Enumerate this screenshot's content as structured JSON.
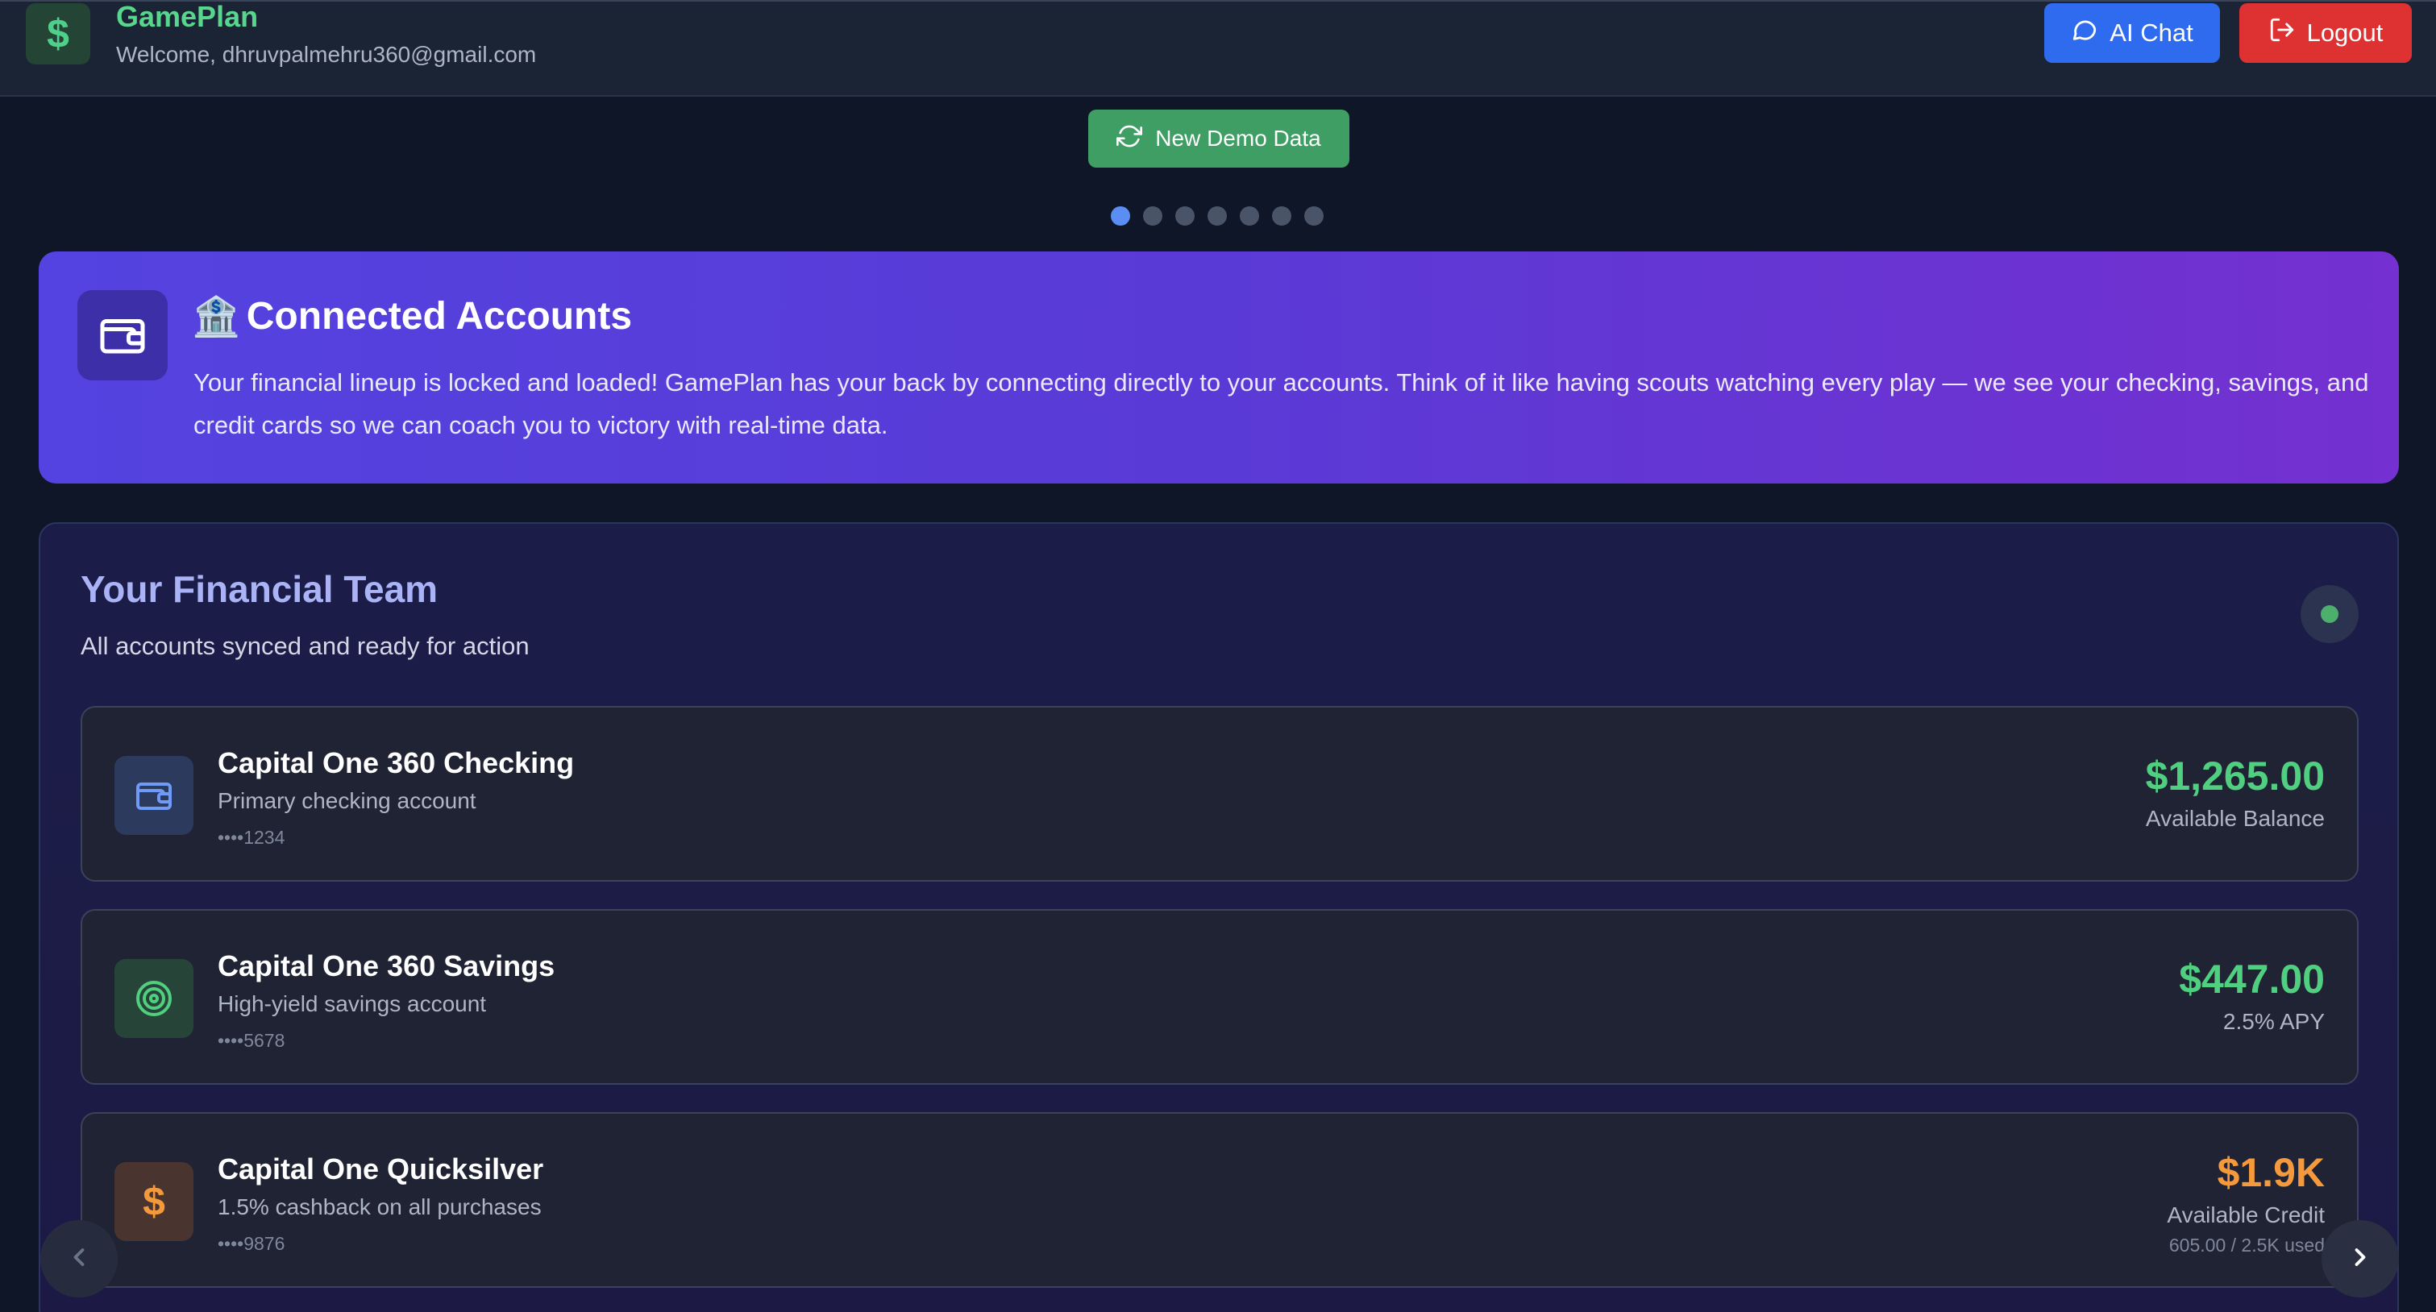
{
  "header": {
    "brand": "GamePlan",
    "logo_glyph": "$",
    "welcome": "Welcome, dhruvpalmehru360@gmail.com",
    "ai_chat_label": "AI Chat",
    "logout_label": "Logout"
  },
  "demo": {
    "label": "New Demo Data"
  },
  "carousel": {
    "total": 7,
    "active": 0
  },
  "hero": {
    "emoji": "🏦",
    "title": "Connected Accounts",
    "text": "Your financial lineup is locked and loaded! GamePlan has your back by connecting directly to your accounts. Think of it like having scouts watching every play — we see your checking, savings, and credit cards so we can coach you to victory with real-time data."
  },
  "team": {
    "title": "Your Financial Team",
    "subtitle": "All accounts synced and ready for action",
    "accounts": [
      {
        "name": "Capital One 360 Checking",
        "description": "Primary checking account",
        "number": "••••1234",
        "amount": "$1,265.00",
        "label": "Available Balance",
        "used": "",
        "icon": "wallet-icon",
        "color": "#4fcf7f"
      },
      {
        "name": "Capital One 360 Savings",
        "description": "High-yield savings account",
        "number": "••••5678",
        "amount": "$447.00",
        "label": "2.5% APY",
        "used": "",
        "icon": "target-icon",
        "color": "#4fcf7f"
      },
      {
        "name": "Capital One Quicksilver",
        "description": "1.5% cashback on all purchases",
        "number": "••••9876",
        "amount": "$1.9K",
        "label": "Available Credit",
        "used": "605.00 / 2.5K used",
        "icon": "dollar-icon",
        "color": "#f59a3c"
      }
    ]
  },
  "colors": {
    "accent_green": "#4fcf7f",
    "accent_orange": "#f59a3c",
    "ai_button": "#2f6bef",
    "logout_button": "#de3131"
  }
}
